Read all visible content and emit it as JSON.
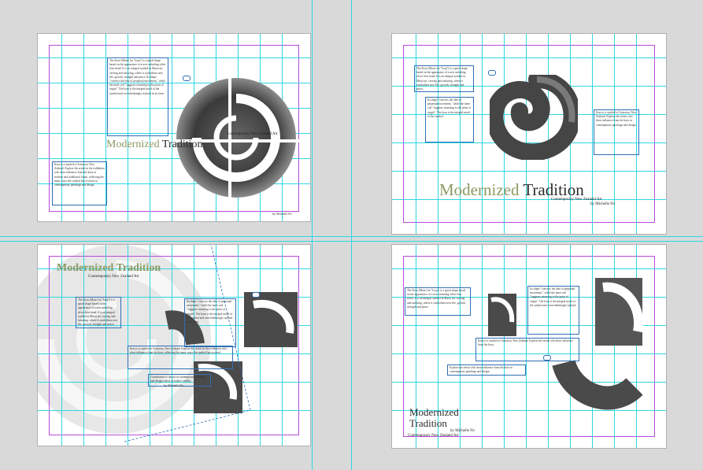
{
  "layouts": {
    "top_left": {
      "title_word1": "Modernized",
      "title_word2": "Tradition",
      "subtitle": "Contemporary New Zealand Art",
      "byline": "by Michelle Fit",
      "body_1": "The Koru (Maori for \"loop\") is a spiral shape based on the appearance of a new unfurling silver fern frond. It is an integral symbol in Maori art, carving and tattooing, where it symbolizes new life, growth, strength and peace. Its shape \"conveys the idea of perpetual movement,\" while the inner coil \"suggests returning to the point of origin\". The koru is the integral motif of the symbol and overwhelmingly stylised in its form.",
      "body_2": "Koru is a symbol of Aotearoa, New Zealand. Explore the artists in the exhibition who draw influence from the koru in modern and traditional forms, reflecting the many ways the symbol has evolved in contemporary paintings and design."
    },
    "top_right": {
      "title_word1": "Modernized",
      "title_word2": "Tradition",
      "subtitle": "Contemporary New Zealand Art",
      "byline": "by Michelle Fit",
      "body_1": "The Koru (Maori for \"loop\") is a spiral shape based on the appearance of a new unfurling silver fern frond. It is an integral symbol in Maori art, carving and tattooing, where it symbolizes new life, growth, strength and peace.",
      "body_2": "Its shape \"conveys the idea of perpetual movement,\" while the inner coil \"suggests returning to the point of origin\". The koru is the integral motif of the symbol.",
      "body_3": "Koru is a symbol of Aotearoa, New Zealand. Explore the artists who draw influence from the koru in contemporary paintings and design."
    },
    "bottom_left": {
      "title_word1": "Modernized",
      "title_word2": "Tradition",
      "subtitle": "Contemporary New Zealand Art",
      "byline": "by Michelle Fit",
      "body_1": "The Koru (Maori for \"loop\") is a spiral shape based on the appearance of a new unfurling silver fern frond. It is an integral symbol in Maori art, carving and tattooing, where it symbolizes new life, growth, strength and peace.",
      "body_2": "Its shape \"conveys the idea of perpetual movement,\" while the inner coil \"suggests returning to the point of origin\". The koru is the integral motif of the symbol and overwhelmingly stylised in its form.",
      "body_3": "Koru is a symbol of Aotearoa, New Zealand. Explore the artists in the exhibition who draw influence from the koru, reflecting the many ways the symbol has evolved.",
      "body_4": "Contributors to the art of contemporary painting and design reflect in today's exhibit."
    },
    "bottom_right": {
      "title_word1": "Modernized",
      "title_word2": "Tradition",
      "subtitle": "Contemporary New Zealand Art",
      "byline": "by Michelle Fit",
      "body_1": "The Koru (Maori for \"loop\") is a spiral shape based on the appearance of a new unfurling silver fern frond. It is an integral symbol in Maori art, carving and tattooing, where it symbolizes new life, growth, strength and peace.",
      "body_2": "Its shape \"conveys the idea of perpetual movement,\" while the inner coil \"suggests returning to the point of origin\". The koru is the integral motif of the symbol and overwhelmingly stylised.",
      "body_3": "Koru is a symbol of Aotearoa, New Zealand. Explore the artists who draw influence from the koru.",
      "body_4": "Explore the artists who draw influence from the koru in contemporary paintings and design."
    }
  },
  "colors": {
    "guide": "#2fd6e3",
    "margin": "#b84ad6",
    "frame": "#2f6fb5",
    "title_accent": "#8b9a62"
  }
}
